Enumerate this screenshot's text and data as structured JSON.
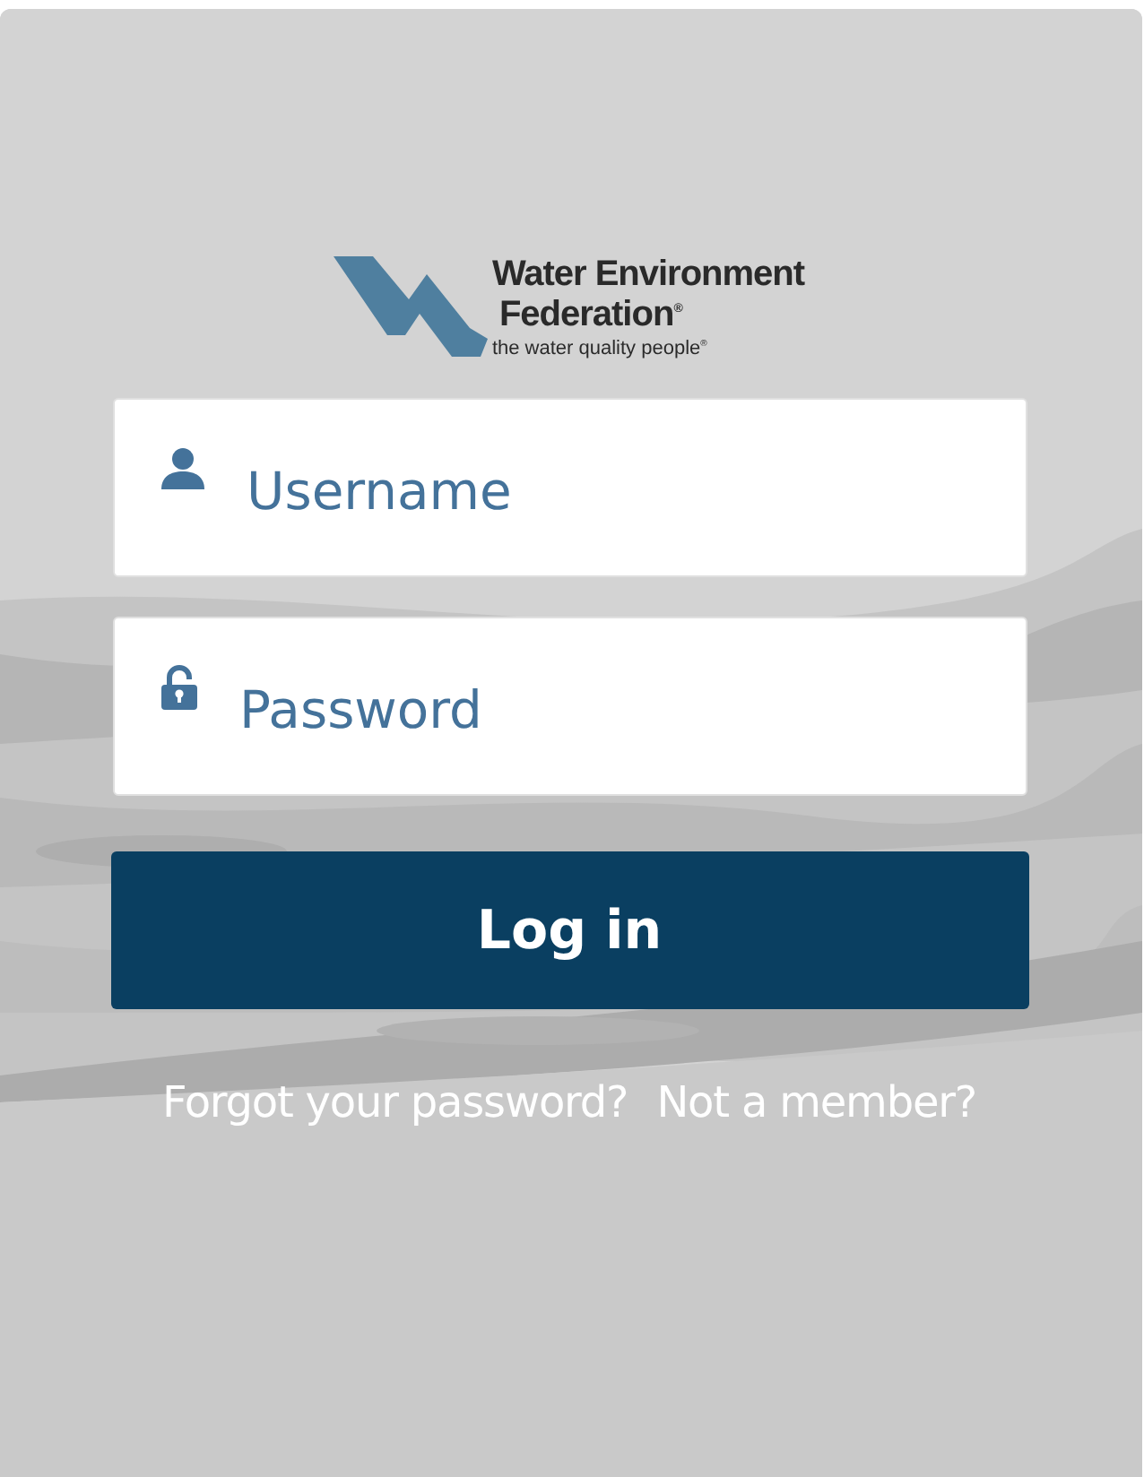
{
  "logo": {
    "name_line_1": "Water Environment",
    "name_line_2": "Federation$^{®}$",
    "tagline": "the water quality people$^{®}$"
  },
  "fields": [
    {
      "kind": "user",
      "placeholder": "Username"
    },
    {
      "kind": "lock",
      "placeholder": "Password"
    }
  ],
  "login_button": "Log in",
  "links": [
    "Forgot your password?",
    "Not a member?"
  ]
}
